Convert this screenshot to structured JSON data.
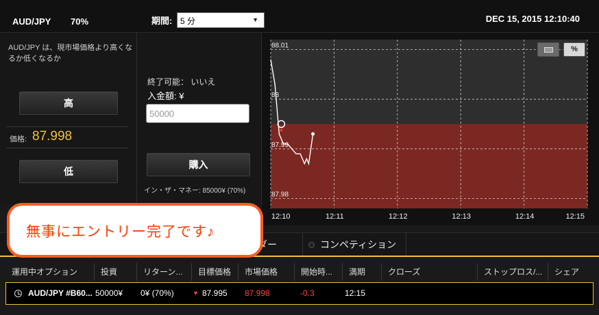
{
  "header": {
    "pair": "AUD/JPY",
    "percent": "70%",
    "period_label": "期間:",
    "period_value": "5 分",
    "datetime": "DEC 15, 2015 12:10:40"
  },
  "left_panel": {
    "description": "AUD/JPY は、現市場価格より高くなるか低くなるか",
    "high_label": "高",
    "low_label": "低",
    "price_label": "価格:",
    "price_value": "87.998"
  },
  "mid_panel": {
    "exit_text": "終了可能： いいえ",
    "deposit_label": "入金額: ¥",
    "amount_placeholder": "50000",
    "buy_label": "購入",
    "money_text": "イン・ザ・マネー: 85000¥ (70%)"
  },
  "chart": {
    "toggle_percent_label": "%",
    "y_labels": [
      "88.01",
      "88",
      "87.99",
      "87.98"
    ],
    "x_labels": [
      "12:10",
      "12:11",
      "12:12",
      "12:13",
      "12:14",
      "12:15"
    ],
    "colors": {
      "below_strike": "#7c2822",
      "line": "#ffffff"
    }
  },
  "chart_data": {
    "type": "line",
    "x": [
      "12:10:00",
      "12:10:04",
      "12:10:08",
      "12:10:10",
      "12:10:12",
      "12:10:16",
      "12:10:20",
      "12:10:24",
      "12:10:28",
      "12:10:32",
      "12:10:34",
      "12:10:36",
      "12:10:38",
      "12:10:40"
    ],
    "y": [
      88.008,
      88.003,
      87.993,
      87.992,
      87.991,
      87.991,
      87.99,
      87.989,
      87.989,
      87.987,
      87.988,
      87.987,
      87.99,
      87.993
    ],
    "strike": 87.995,
    "xlim": [
      "12:10",
      "12:15"
    ],
    "ylim": [
      87.978,
      88.012
    ],
    "grid": true
  },
  "tabs": {
    "calendar_partial": "ンダー",
    "competition": "コンペティション"
  },
  "table": {
    "headers": [
      "運用中オプション",
      "投資",
      "リターン...",
      "目標価格",
      "市場価格",
      "開始時...",
      "満期",
      "クローズ",
      "ストップロス/...",
      "シェア"
    ],
    "row": {
      "option": "AUD/JPY #B60...",
      "investment": "50000¥",
      "return": "0¥ (70%)",
      "target_price": "87.995",
      "market_price": "87.998",
      "start": "-0.3",
      "expiry": "12:15"
    }
  },
  "toast": {
    "message": "無事にエントリー完了です♪"
  }
}
